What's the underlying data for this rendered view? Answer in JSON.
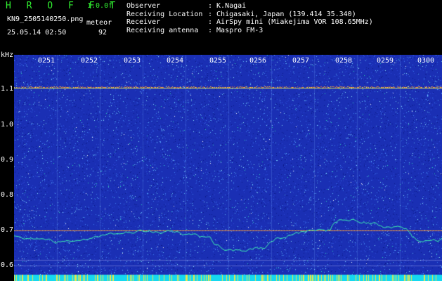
{
  "header": {
    "app_title": "H R O F F T",
    "version": "1.0.0f",
    "file_name": "KN9_2505140250.png",
    "meteor_label": "meteor",
    "timestamp": "25.05.14 02:50",
    "meteor_count": "92"
  },
  "info": [
    {
      "label": "Observer",
      "value": ": K.Nagai"
    },
    {
      "label": "Receiving Location",
      "value": ": Chigasaki, Japan (139.414 35.340)"
    },
    {
      "label": "Receiver",
      "value": ": AirSpy mini (Miakejima VOR 108.65MHz)"
    },
    {
      "label": "Receiving antenna",
      "value": ": Maspro FM-3"
    }
  ],
  "axis": {
    "unit": "kHz",
    "y_ticks": [
      "1.1",
      "1.0",
      "0.9",
      "0.8",
      "0.7",
      "0.6"
    ],
    "time_ticks": [
      "0251",
      "0252",
      "0253",
      "0254",
      "0255",
      "0256",
      "0257",
      "0258",
      "0259",
      "0300"
    ]
  },
  "colors": {
    "background": "#000000",
    "spectrogram_base": "#1a2fb4",
    "title_green": "#31f231",
    "carrier_line": "#e8c24a",
    "trace_line": "#3ef2b0",
    "bottom_bar": "#16d8f0"
  }
}
